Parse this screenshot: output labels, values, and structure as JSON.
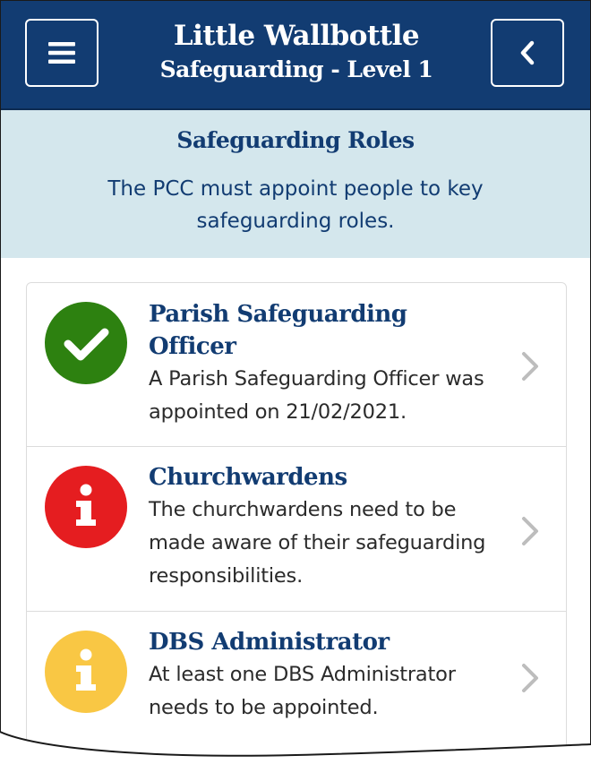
{
  "header": {
    "title": "Little Wallbottle",
    "subtitle": "Safeguarding - Level 1",
    "menu_icon": "hamburger-menu-icon",
    "back_icon": "chevron-left-icon"
  },
  "intro": {
    "heading": "Safeguarding Roles",
    "description": "The PCC must appoint people to key safeguarding roles."
  },
  "roles": [
    {
      "title": "Parish Safeguarding Officer",
      "description": "A Parish Safeguarding Officer was appointed on 21/02/2021.",
      "status": "complete",
      "status_icon": "check-circle-icon",
      "color": "#2d8110"
    },
    {
      "title": "Churchwardens",
      "description": "The churchwardens need to be made aware of their safeguarding responsibilities.",
      "status": "action-required",
      "status_icon": "info-circle-icon",
      "color": "#e51d20"
    },
    {
      "title": "DBS Administrator",
      "description": "At least one DBS Administrator needs to be appointed.",
      "status": "warning",
      "status_icon": "info-circle-icon",
      "color": "#f9c744"
    }
  ],
  "colors": {
    "brand": "#123c72",
    "intro_bg": "#d4e7ed",
    "chevron": "#bdbdbd"
  }
}
